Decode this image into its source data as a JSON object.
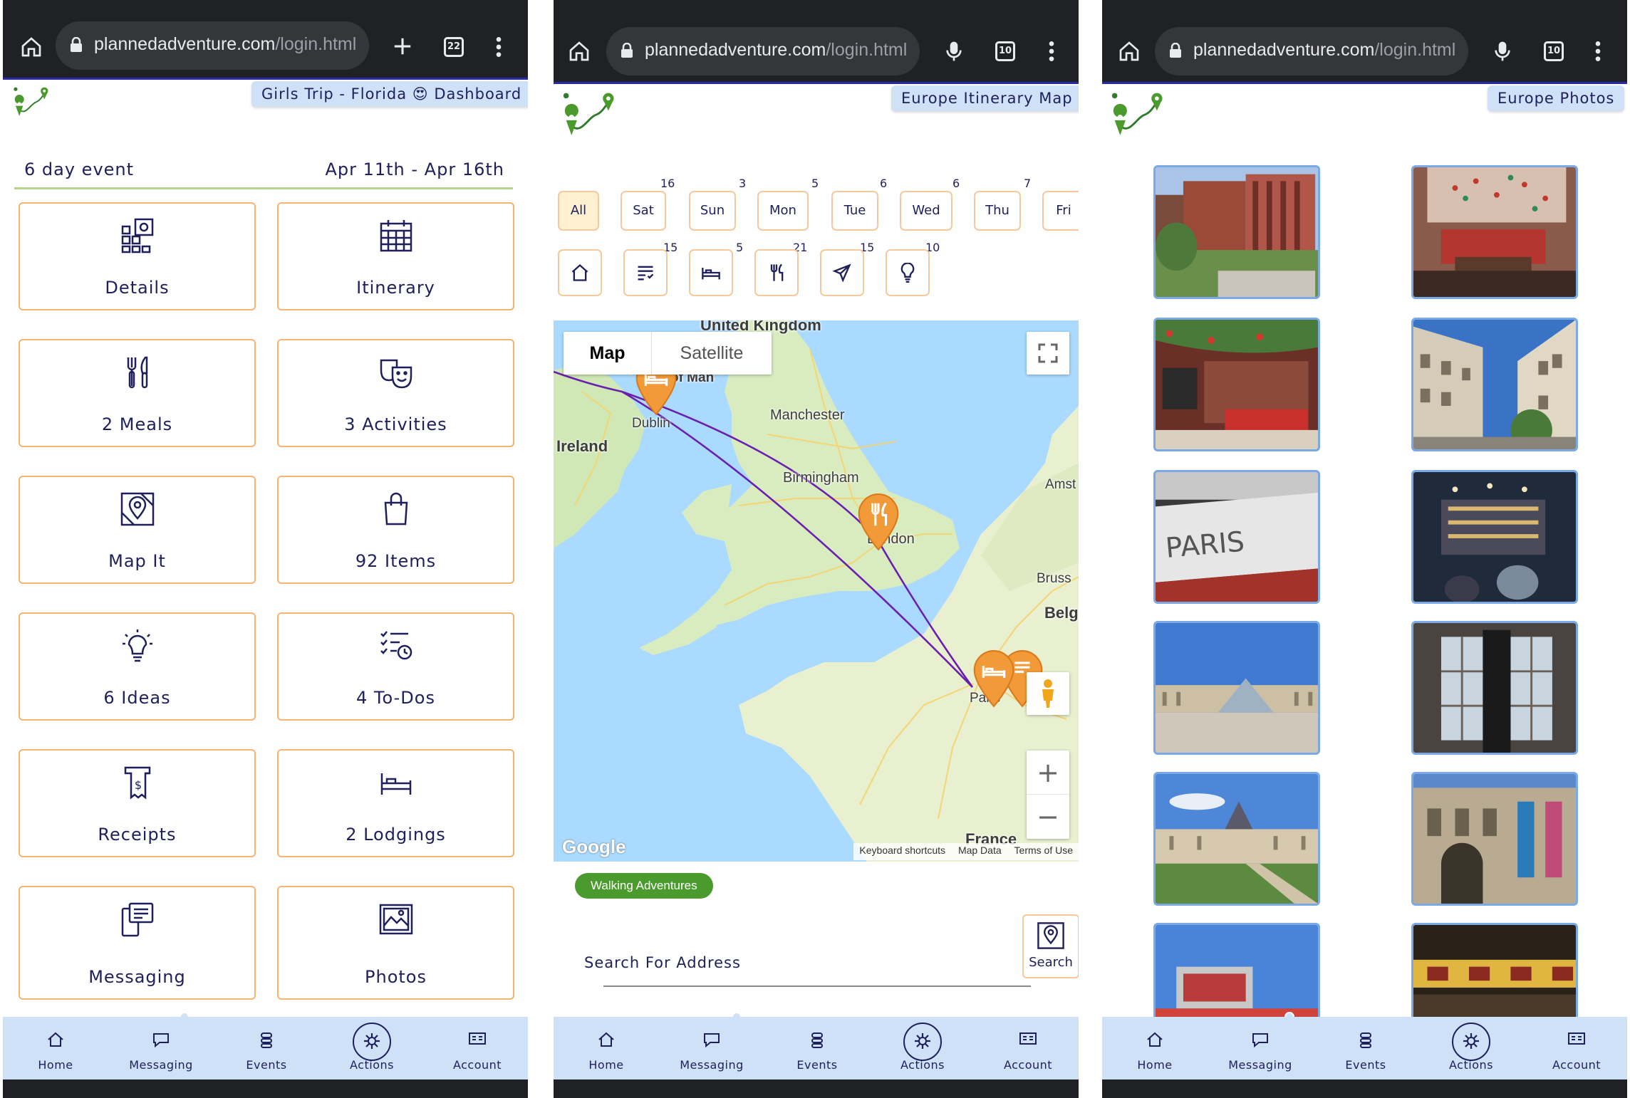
{
  "browser": {
    "host": "plannedadventure.com",
    "path": "/login.html",
    "tab_count_1": "22",
    "tab_count_2": "10",
    "tab_count_3": "10"
  },
  "dashboard": {
    "title_chip": "Girls Trip - Florida 😍 Dashboard",
    "event_length": "6 day event",
    "event_dates": "Apr 11th - Apr 16th",
    "tiles": [
      {
        "label": "Details",
        "icon": "details-icon"
      },
      {
        "label": "Itinerary",
        "icon": "calendar-icon"
      },
      {
        "label": "2 Meals",
        "icon": "utensils-icon"
      },
      {
        "label": "3 Activities",
        "icon": "theater-masks-icon"
      },
      {
        "label": "Map It",
        "icon": "map-pin-icon"
      },
      {
        "label": "92 Items",
        "icon": "shopping-bag-icon"
      },
      {
        "label": "6 Ideas",
        "icon": "lightbulb-icon"
      },
      {
        "label": "4 To-Dos",
        "icon": "checklist-icon"
      },
      {
        "label": "Receipts",
        "icon": "receipt-icon"
      },
      {
        "label": "2 Lodgings",
        "icon": "bed-icon"
      },
      {
        "label": "Messaging",
        "icon": "messaging-icon"
      },
      {
        "label": "Photos",
        "icon": "photos-icon"
      }
    ]
  },
  "itinerary_map": {
    "title_chip": "Europe Itinerary Map",
    "days": [
      {
        "label": "All",
        "count": ""
      },
      {
        "label": "Sat",
        "count": "16"
      },
      {
        "label": "Sun",
        "count": "3"
      },
      {
        "label": "Mon",
        "count": "5"
      },
      {
        "label": "Tue",
        "count": "6"
      },
      {
        "label": "Wed",
        "count": "6"
      },
      {
        "label": "Thu",
        "count": "7"
      },
      {
        "label": "Fri",
        "count": ""
      }
    ],
    "categories": [
      {
        "icon": "home-icon",
        "count": ""
      },
      {
        "icon": "notes-icon",
        "count": "15"
      },
      {
        "icon": "bed-icon",
        "count": "5"
      },
      {
        "icon": "utensils-icon",
        "count": "21"
      },
      {
        "icon": "plane-icon",
        "count": "15"
      },
      {
        "icon": "lightbulb-icon",
        "count": "10"
      }
    ],
    "map": {
      "type_map": "Map",
      "type_satellite": "Satellite",
      "places": {
        "united_kingdom": "United Kingdom",
        "isle_of_man": "Isle of Man",
        "ireland": "Ireland",
        "dublin": "Dublin",
        "manchester": "Manchester",
        "birmingham": "Birmingham",
        "london": "London",
        "amsterdam": "Amst",
        "brussels": "Bruss",
        "belgium": "Belg",
        "paris": "Paris",
        "france": "France"
      },
      "google": "Google",
      "footer": [
        "Keyboard shortcuts",
        "Map Data",
        "Terms of Use"
      ],
      "zoom_in": "+",
      "zoom_out": "−"
    },
    "walking_chip": "Walking Adventures",
    "search_placeholder": "Search For Address",
    "search_button": "Search"
  },
  "photos_page": {
    "title_chip": "Europe Photos"
  },
  "bottom_nav": [
    {
      "label": "Home",
      "icon": "home-icon"
    },
    {
      "label": "Messaging",
      "icon": "chat-icon"
    },
    {
      "label": "Events",
      "icon": "events-icon"
    },
    {
      "label": "Actions",
      "icon": "actions-icon"
    },
    {
      "label": "Account",
      "icon": "account-icon"
    }
  ],
  "colors": {
    "navy": "#1f1f5c",
    "tile_border": "#f3b56f",
    "nav_bg": "#cfe1f7",
    "pin_orange": "#f29a38",
    "logo_green": "#4a9a2e",
    "route_purple": "#6b1fb0"
  }
}
